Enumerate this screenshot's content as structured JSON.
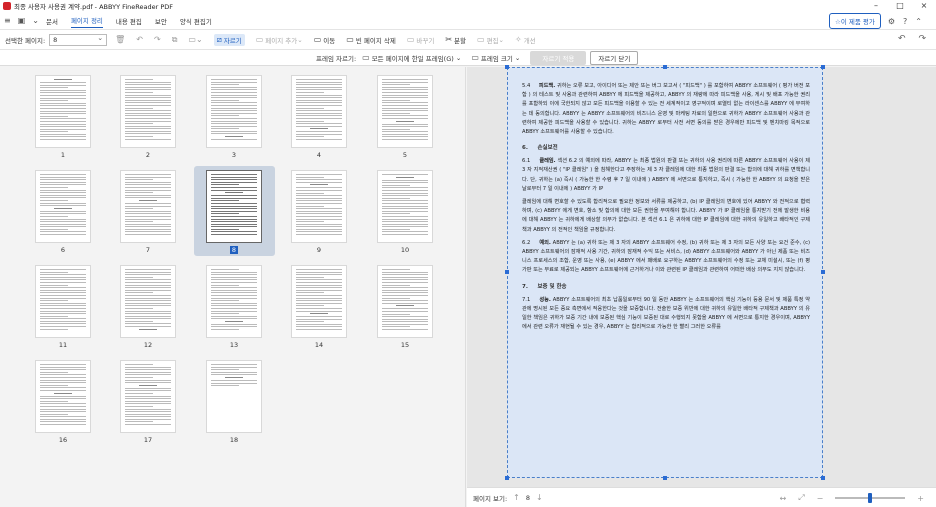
{
  "window": {
    "title": "최종 사용자 사용권 계약.pdf - ABBYY FineReader PDF"
  },
  "menu": {
    "items": [
      {
        "label": "문서",
        "active": false
      },
      {
        "label": "페이지 정리",
        "active": true
      },
      {
        "label": "내용 편집",
        "active": false
      },
      {
        "label": "보안",
        "active": false
      },
      {
        "label": "양식 편집기",
        "active": false
      }
    ],
    "rate_label": "이 제품 평가"
  },
  "toolbar": {
    "selected_pages_label": "선택한 페이지:",
    "selected_pages_value": "8",
    "crop_label": "자르기",
    "add_page_label": "페이지 추가",
    "move_label": "이동",
    "delete_blank_label": "빈 페이지 삭제",
    "replace_label": "바꾸기",
    "split_label": "분할",
    "edit_label": "편집",
    "improve_label": "개선"
  },
  "framebar": {
    "frame_crop_label": "프레임 자르기:",
    "all_pages_label": "모든 페이지에 한일 프레임(G)",
    "frame_size_label": "프레임 크기",
    "crop_btn_label": "자르기 적용",
    "close_crop_label": "자르기 닫기"
  },
  "thumbnails": {
    "pages": [
      "1",
      "2",
      "3",
      "4",
      "5",
      "6",
      "7",
      "8",
      "9",
      "10",
      "11",
      "12",
      "13",
      "14",
      "15",
      "16",
      "17",
      "18"
    ],
    "selected": "8"
  },
  "document": {
    "paragraphs": [
      {
        "type": "p",
        "num": "5.4",
        "bold": "피드백.",
        "text": " 귀하는 오류 보고, 아이디어 또는 제안 또는 버그 보고서 ( \"피드백\" ) 를 포함하여 ABBYY 소프트웨어 ( 평가 버전 포함 ) 의 테스트 및 사용과 관련하여 ABBYY 에 피드백을 제공하고, ABBYY 의 재량에 따라 피드백을 사용, 게시 및 배포 가능한 권리를 포함하되 이에 국한되지 않고 모든 피드백을 이용할 수 있는 전 세계적이고 영구적이며 로열티 없는 라이센스를 ABBYY 에 부여하는 데 동의합니다. ABBYY 는 ABBYY 소프트웨어의 비즈니스 운영 및 마케팅 자료의 일환으로 귀하가 ABBYY 소프트웨어 사용과 관련하여 제공한 피드백을 사용할 수 있습니다. 귀하는 ABBYY 로부터 사전 서면 동의를 받은 경우에만 피드백 및 벤치마킹 목적으로 ABBYY 소프트웨어를 사용할 수 있습니다."
      },
      {
        "type": "h",
        "num": "6.",
        "text": "손실보전"
      },
      {
        "type": "p",
        "num": "6.1",
        "bold": "클레임.",
        "text": " 섹션 6.2 의 예외에 따라, ABBYY 는 최종 법원의 판결 또는 귀하의 사용 권리에 따른 ABBYY 소프트웨어 사용이 제 3 자 지적재산권 ( \"IP 클레임\" ) 을 침해한다고 주장하는 제 3 자 클레임에 대한 최종 법원의 판결 또는 합의에 대해 귀하를 면책합니다. 단, 귀하는 (a) 즉시 ( 가능한 한 수령 후 7 일 이내에 ) ABBYY 에 서면으로 통지하고, 즉시 ( 가능한 한 ABBYY 의 요청을 받은 날로부터 7 일 이내에 ) ABBYY 가 IP"
      },
      {
        "type": "p",
        "num": "",
        "bold": "",
        "text": "클레임에 대해 변호할 수 있도록 합리적으로 필요한 정보와 서류를 제공하고, (b) IP 클레임의 변호에 있어 ABBYY 와 전적으로 협력하며, (c) ABBYY 에게 변호, 항소 및 합의에 대한 모든 권한을 부여해야 합니다. ABBYY 가 IP 클레임을 통지받기 전에 발생한 비용에 대해 ABBYY 는 귀하에게 배상할 의무가 없습니다. 본 섹션 6.1 은 귀하에 대한 IP 클레임에 대한 귀하의 유일하고 배타적인 구제책과 ABBYY 의 전적인 책임을 규정합니다."
      },
      {
        "type": "p",
        "num": "6.2",
        "bold": "예외.",
        "text": " ABBYY 는 (a) 귀하 또는 제 3 자의 ABBYY 소프트웨어 수정, (b) 귀하 또는 제 3 자의 모든 사양 또는 요건 준수, (c) ABBYY 소프트웨어의 잠재적 사용 기간, 귀하의 잠재적 수익 또는 서비스, (d) ABBYY 소프트웨어와 ABBYY 가 아닌 제품 또는 비즈니스 프로세스의 조합, 운영 또는 사용, (e) ABBYY 에서 패배로 요구하는 ABBYY 소프트웨어의 수정 또는 교체 미설시, 또는 (f) 평가판 또는 무료로 제공되는 ABBYY 소프트웨어에 근거하거나 이와 관련된 IP 클레임과 관련하여 어떠한 배상 의무도 지지 않습니다."
      },
      {
        "type": "h",
        "num": "7.",
        "text": "보증 및 한송"
      },
      {
        "type": "p",
        "num": "7.1",
        "bold": "성능.",
        "text": " ABBYY 소프트웨어의 최초 납품일로부터 90 일 동안 ABBYY 는 소프트웨어의 핵심 기능이 등용 문서 및 제품 특정 약관에 명시된 모든 중요 측면에서 적응한다는 것을 보증합니다. 전술한 보증 위반에 대한 귀하의 유일한 배타적 구제책과 ABBYY 의 유일한 책임은 귀하가 보증 기간 내에 보증된 핵심 기능이 보증된 대로 수행되지 못함을 ABBYY 에 서면으로 통지한 경우이며, ABBYY 에서 관련 오류가 재현될 수 있는 경우, ABBYY 는 합리적으로 가능한 한 빨리 그러한 오류를"
      }
    ]
  },
  "status": {
    "page_view_label": "페이지 보기:",
    "current_page": "8",
    "zoom_fraction": 0.5
  },
  "colors": {
    "accent": "#1f5fbf",
    "logo": "#d2232a",
    "selection": "#dbe6f6"
  }
}
